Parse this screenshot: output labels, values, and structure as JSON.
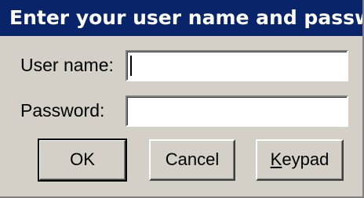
{
  "dialog": {
    "title": "Enter your user name and password.",
    "username_label": "User name:",
    "password_label": "Password:",
    "username_value": "",
    "password_value": "",
    "buttons": {
      "ok": "OK",
      "cancel": "Cancel",
      "keypad_mnemonic": "K",
      "keypad_rest": "eypad"
    }
  },
  "colors": {
    "titlebar_bg": "#0a246a",
    "titlebar_text": "#ffffff",
    "dialog_bg": "#d4d0c8"
  }
}
